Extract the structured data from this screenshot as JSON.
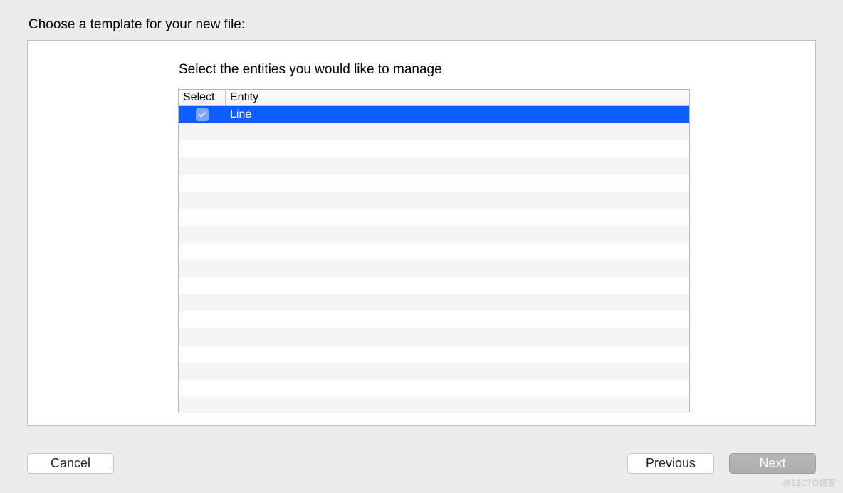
{
  "page_title": "Choose a template for your new file:",
  "subtitle": "Select the entities you would like to manage",
  "columns": {
    "select": "Select",
    "entity": "Entity"
  },
  "rows": [
    {
      "checked": true,
      "entity": "Line",
      "selected": true
    }
  ],
  "empty_row_count": 18,
  "buttons": {
    "cancel": "Cancel",
    "previous": "Previous",
    "next": "Next"
  },
  "watermark": "@51CTO博客"
}
